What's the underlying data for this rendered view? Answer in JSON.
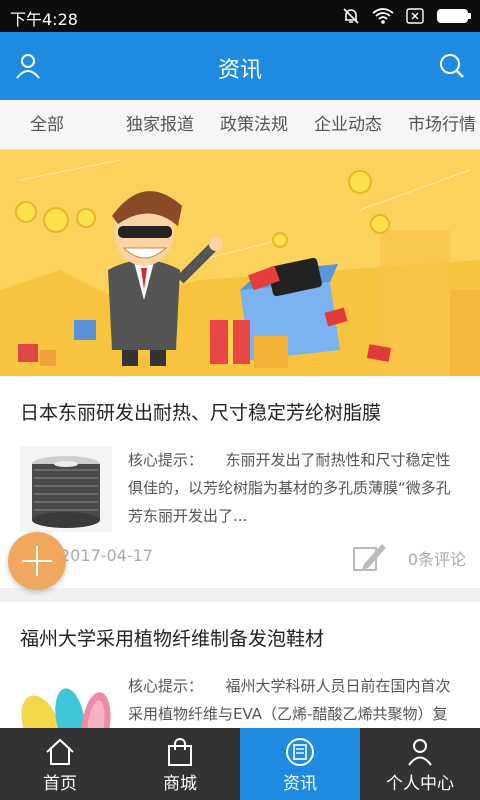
{
  "status_bar": {
    "time": "下午4:28"
  },
  "app_bar": {
    "title": "资讯",
    "left_icon": "user-icon",
    "right_icon": "search-icon",
    "color": "#1e8be0"
  },
  "tabs": [
    "全部",
    "独家报道",
    "政策法规",
    "企业动态",
    "市场行情"
  ],
  "articles": [
    {
      "title": "日本东丽研发出耐热、尺寸稳定芳纶树脂膜",
      "summary": "核心提示：　　东丽开发出了耐热性和尺寸稳定性俱佳的，以芳纶树脂为基材的多孔质薄膜“微多孔芳东丽开发出了...",
      "date": "2017-04-17",
      "comments": "0条评论"
    },
    {
      "title": "福州大学采用植物纤维制备发泡鞋材",
      "summary": "核心提示：　　福州大学科研人员日前在国内首次采用植物纤维与EVA（乙烯-醋酸乙烯共聚物）复合，制福州大学..."
    }
  ],
  "bottom_nav": [
    {
      "label": "首页",
      "icon": "home-icon"
    },
    {
      "label": "商城",
      "icon": "shopping-bag-icon"
    },
    {
      "label": "资讯",
      "icon": "news-icon",
      "active": true
    },
    {
      "label": "个人中心",
      "icon": "person-icon"
    }
  ]
}
